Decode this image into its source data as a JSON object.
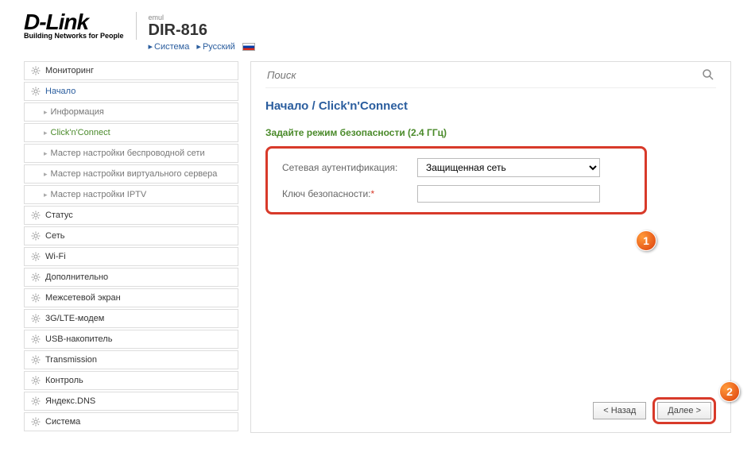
{
  "header": {
    "logo_main": "D-Link",
    "logo_tag": "Building Networks for People",
    "emul": "emul",
    "model": "DIR-816",
    "crumbs": {
      "system": "Система",
      "lang": "Русский"
    }
  },
  "sidebar": {
    "items": [
      {
        "label": "Мониторинг",
        "type": "main"
      },
      {
        "label": "Начало",
        "type": "main",
        "active": true
      },
      {
        "label": "Информация",
        "type": "sub"
      },
      {
        "label": "Click'n'Connect",
        "type": "sub",
        "active": true
      },
      {
        "label": "Мастер настройки беспроводной сети",
        "type": "sub"
      },
      {
        "label": "Мастер настройки виртуального сервера",
        "type": "sub"
      },
      {
        "label": "Мастер настройки IPTV",
        "type": "sub"
      },
      {
        "label": "Статус",
        "type": "main"
      },
      {
        "label": "Сеть",
        "type": "main"
      },
      {
        "label": "Wi-Fi",
        "type": "main"
      },
      {
        "label": "Дополнительно",
        "type": "main"
      },
      {
        "label": "Межсетевой экран",
        "type": "main"
      },
      {
        "label": "3G/LTE-модем",
        "type": "main"
      },
      {
        "label": "USB-накопитель",
        "type": "main"
      },
      {
        "label": "Transmission",
        "type": "main"
      },
      {
        "label": "Контроль",
        "type": "main"
      },
      {
        "label": "Яндекс.DNS",
        "type": "main"
      },
      {
        "label": "Система",
        "type": "main"
      }
    ]
  },
  "search": {
    "placeholder": "Поиск"
  },
  "breadcrumb": "Начало /  Click'n'Connect",
  "section_title": "Задайте режим безопасности (2.4 ГГц)",
  "form": {
    "auth_label": "Сетевая аутентификация:",
    "auth_value": "Защищенная сеть",
    "key_label": "Ключ безопасности:",
    "key_value": ""
  },
  "buttons": {
    "back": "< Назад",
    "next": "Далее >"
  },
  "callouts": {
    "one": "1",
    "two": "2"
  }
}
